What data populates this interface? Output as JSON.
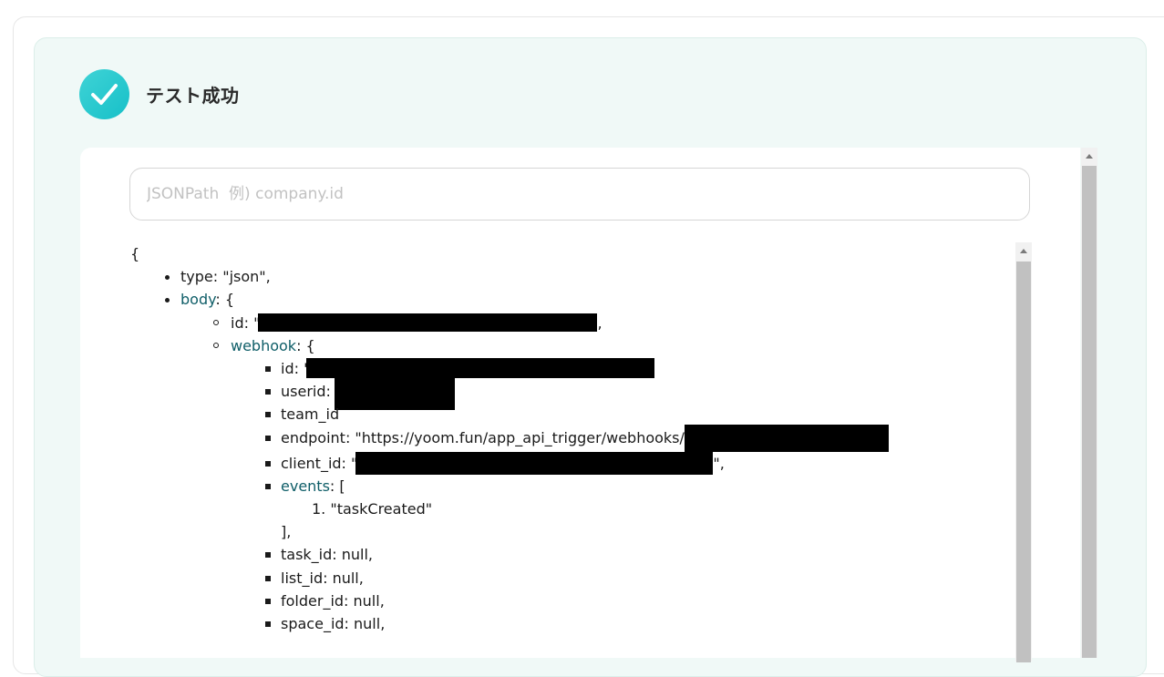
{
  "status": {
    "title": "テスト成功",
    "icon": "check-icon",
    "accent": "#1fc6cc"
  },
  "search": {
    "placeholder": "JSONPath  例) company.id"
  },
  "json": {
    "open_brace": "{",
    "type_line": "type: \"json\",",
    "body_key": "body",
    "body_suffix": ": {",
    "body_id_prefix": "id: \"",
    "body_id_suffix": ",",
    "webhook_key": "webhook",
    "webhook_suffix": ": {",
    "wh_id_prefix": "id: \"",
    "userid_prefix": "userid: \"",
    "team_id_prefix": "team_id",
    "endpoint_prefix": "endpoint: \"https://yoom.fun/app_api_trigger/webhooks/",
    "client_id_prefix": "client_id: \"",
    "client_id_suffix": "\",",
    "events_key": "events",
    "events_suffix": ": [",
    "events_item_number": "1.",
    "events_item": "\"taskCreated\"",
    "events_close": "],",
    "task_id": "task_id: null,",
    "list_id": "list_id: null,",
    "folder_id": "folder_id: null,",
    "space_id": "space_id: null,"
  }
}
